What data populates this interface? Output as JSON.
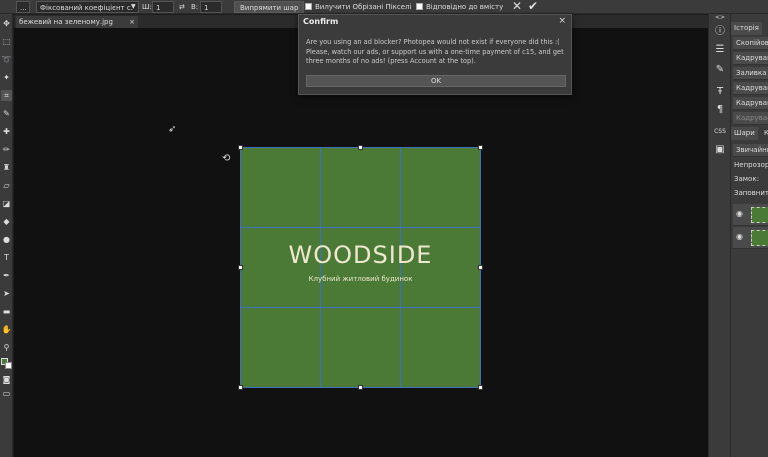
{
  "options_bar": {
    "menu_btn": "...",
    "mode": "Фіксований коефіцієнт с.",
    "width_label": "Ш:",
    "width_value": "1",
    "swap_icon": "⇄",
    "height_label": "В:",
    "height_value": "1",
    "straighten_label": "Випрямити шар",
    "delete_cropped_label": "Вилучити Обрізані Пікселі",
    "fit_content_label": "Відповідно до вмісту"
  },
  "document": {
    "tab_name": "бежевий на зеленому.jpg",
    "tab_close": "×",
    "canvas_color": "#4a7a35",
    "logo_text": "WOODSIDE",
    "logo_subtext": "Клубний житловий будинок"
  },
  "dialog": {
    "title": "Confirm",
    "close": "×",
    "message": "Are you using an ad blocker? Photopea would not exist if everyone did this :( Please, watch our ads, or support us with a one-time payment of c15, and get three months of no ads! (press Account at the top).",
    "ok_label": "OK"
  },
  "right_panel": {
    "history_tab": "Історія",
    "history_items": [
      "Скопійовано",
      "Кадрування",
      "Заливка",
      "Кадрування",
      "Кадрування",
      "Кадрування"
    ],
    "layers_tab": "Шари",
    "layers_tab2": "К",
    "blend_mode": "Звичайний",
    "opacity_label": "Непрозорість",
    "lock_label": "Замок:",
    "fill_label": "Заповнити",
    "css_label": "CSS",
    "collapse": "<>"
  },
  "icons": {
    "commit": "check-icon",
    "cancel": "close-icon"
  }
}
